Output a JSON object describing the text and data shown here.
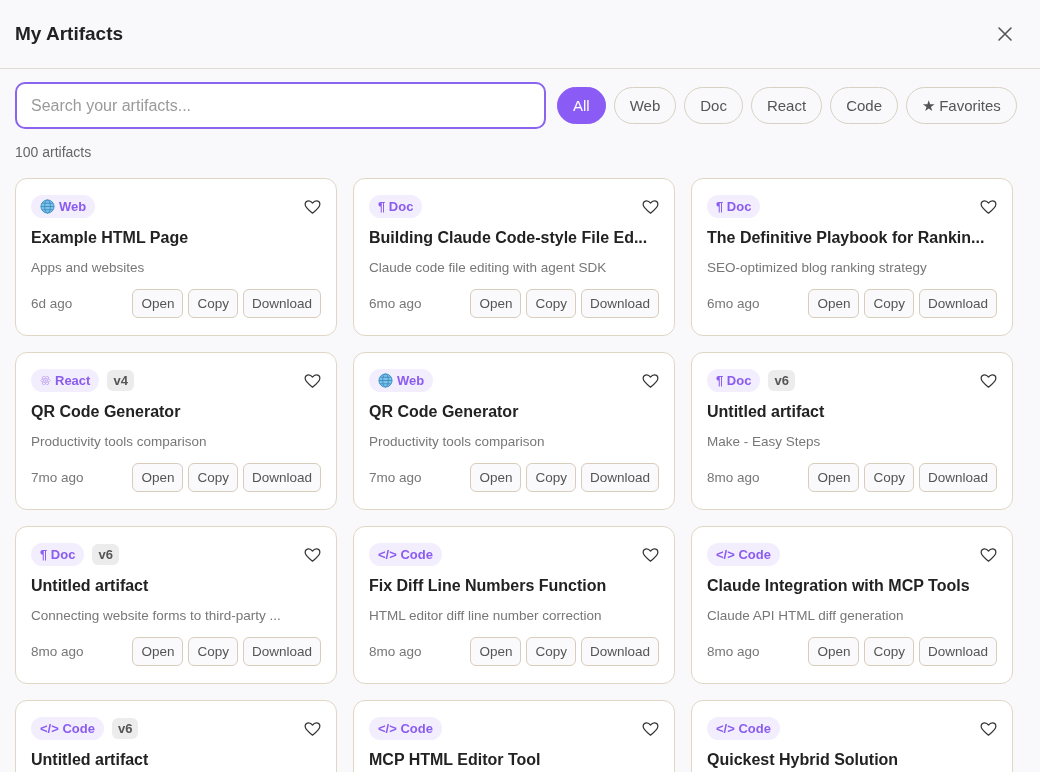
{
  "title": "My Artifacts",
  "search": {
    "placeholder": "Search your artifacts..."
  },
  "filters": [
    {
      "label": "All",
      "selected": true
    },
    {
      "label": "Web",
      "selected": false
    },
    {
      "label": "Doc",
      "selected": false
    },
    {
      "label": "React",
      "selected": false
    },
    {
      "label": "Code",
      "selected": false
    },
    {
      "label": "★ Favorites",
      "selected": false
    }
  ],
  "count": "100 artifacts",
  "cards": [
    {
      "kind": "web",
      "type_label": "Web",
      "title": "Example HTML Page",
      "description": "Apps and websites",
      "time": "6d ago",
      "favorite": false,
      "actions": [
        "Open",
        "Copy",
        "Download"
      ]
    },
    {
      "kind": "doc",
      "type_label": "¶ Doc",
      "title": "Building Claude Code-style File Ed...",
      "description": "Claude code file editing with agent SDK",
      "time": "6mo ago",
      "favorite": false,
      "actions": [
        "Open",
        "Copy",
        "Download"
      ]
    },
    {
      "kind": "doc",
      "type_label": "¶ Doc",
      "title": "The Definitive Playbook for Rankin...",
      "description": "SEO-optimized blog ranking strategy",
      "time": "6mo ago",
      "favorite": false,
      "actions": [
        "Open",
        "Copy",
        "Download"
      ]
    },
    {
      "kind": "react",
      "type_label": "React",
      "version": "v4",
      "title": "QR Code Generator",
      "description": "Productivity tools comparison",
      "time": "7mo ago",
      "favorite": false,
      "actions": [
        "Open",
        "Copy",
        "Download"
      ]
    },
    {
      "kind": "web",
      "type_label": "Web",
      "title": "QR Code Generator",
      "description": "Productivity tools comparison",
      "time": "7mo ago",
      "favorite": false,
      "actions": [
        "Open",
        "Copy",
        "Download"
      ]
    },
    {
      "kind": "doc",
      "type_label": "¶ Doc",
      "version": "v6",
      "title": "Untitled artifact",
      "description": "Make - Easy Steps",
      "time": "8mo ago",
      "favorite": false,
      "actions": [
        "Open",
        "Copy",
        "Download"
      ]
    },
    {
      "kind": "doc",
      "type_label": "¶ Doc",
      "version": "v6",
      "title": "Untitled artifact",
      "description": "Connecting website forms to third-party ...",
      "time": "8mo ago",
      "favorite": false,
      "actions": [
        "Open",
        "Copy",
        "Download"
      ]
    },
    {
      "kind": "code",
      "type_label": "</> Code",
      "title": "Fix Diff Line Numbers Function",
      "description": "HTML editor diff line number correction",
      "time": "8mo ago",
      "favorite": false,
      "actions": [
        "Open",
        "Copy",
        "Download"
      ]
    },
    {
      "kind": "code",
      "type_label": "</> Code",
      "title": "Claude Integration with MCP Tools",
      "description": "Claude API HTML diff generation",
      "time": "8mo ago",
      "favorite": false,
      "actions": [
        "Open",
        "Copy",
        "Download"
      ]
    },
    {
      "kind": "code",
      "type_label": "</> Code",
      "version": "v6",
      "title": "Untitled artifact",
      "favorite": false
    },
    {
      "kind": "code",
      "type_label": "</> Code",
      "title": "MCP HTML Editor Tool",
      "favorite": false
    },
    {
      "kind": "code",
      "type_label": "</> Code",
      "title": "Quickest Hybrid Solution",
      "favorite": false
    }
  ]
}
